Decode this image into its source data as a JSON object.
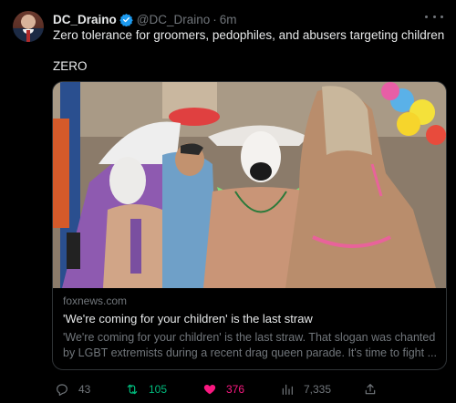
{
  "tweet": {
    "author_name": "DC_Draino",
    "handle": "@DC_Draino",
    "separator": "·",
    "time": "6m",
    "text_line1": "Zero tolerance for groomers, pedophiles, and abusers targeting children",
    "text_line2": "ZERO",
    "verified_color": "#1d9bf0"
  },
  "card": {
    "domain": "foxnews.com",
    "title": "'We're coming for your children' is the last straw",
    "description_line1": "'We're coming for your children' is the last straw. That slogan was chanted",
    "description_line2": "by LGBT extremists during a recent drag queen parade. It's time to fight ..."
  },
  "actions": {
    "replies": "43",
    "retweets": "105",
    "likes": "376",
    "views": "7,335",
    "retweet_color": "#00ba7c",
    "like_color": "#f91880"
  },
  "icons": [
    "verified-badge-icon",
    "more-icon",
    "reply-icon",
    "retweet-icon",
    "heart-icon",
    "views-icon",
    "share-icon"
  ]
}
